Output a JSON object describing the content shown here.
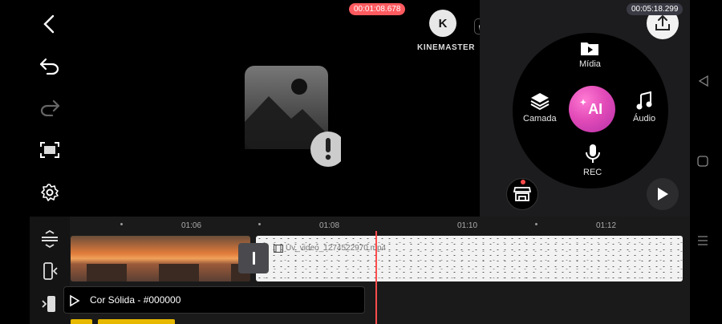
{
  "app": {
    "brand": "KINEMASTER",
    "brand_letter": "K"
  },
  "toolbar": {
    "back": "back-icon",
    "undo": "undo-icon",
    "redo": "redo-icon",
    "fullscreen": "fullscreen-icon",
    "settings": "settings-icon"
  },
  "wheel": {
    "media_label": "Mídia",
    "layer_label": "Camada",
    "audio_label": "Áudio",
    "rec_label": "REC",
    "ai_label": "AI"
  },
  "timeline": {
    "ticks": [
      "01:06",
      "01:08",
      "01:10",
      "01:12"
    ],
    "playhead_time": "00:01:08.678",
    "total_time": "00:05:18.299",
    "clip_b_label": "Uv_video_1274522970.mp4",
    "layer_label": "Cor Sólida - #000000"
  },
  "colors": {
    "accent_playhead": "#ff5a5f",
    "ai_gradient": "#e24bb8",
    "layer_yellow": "#e6b800"
  }
}
